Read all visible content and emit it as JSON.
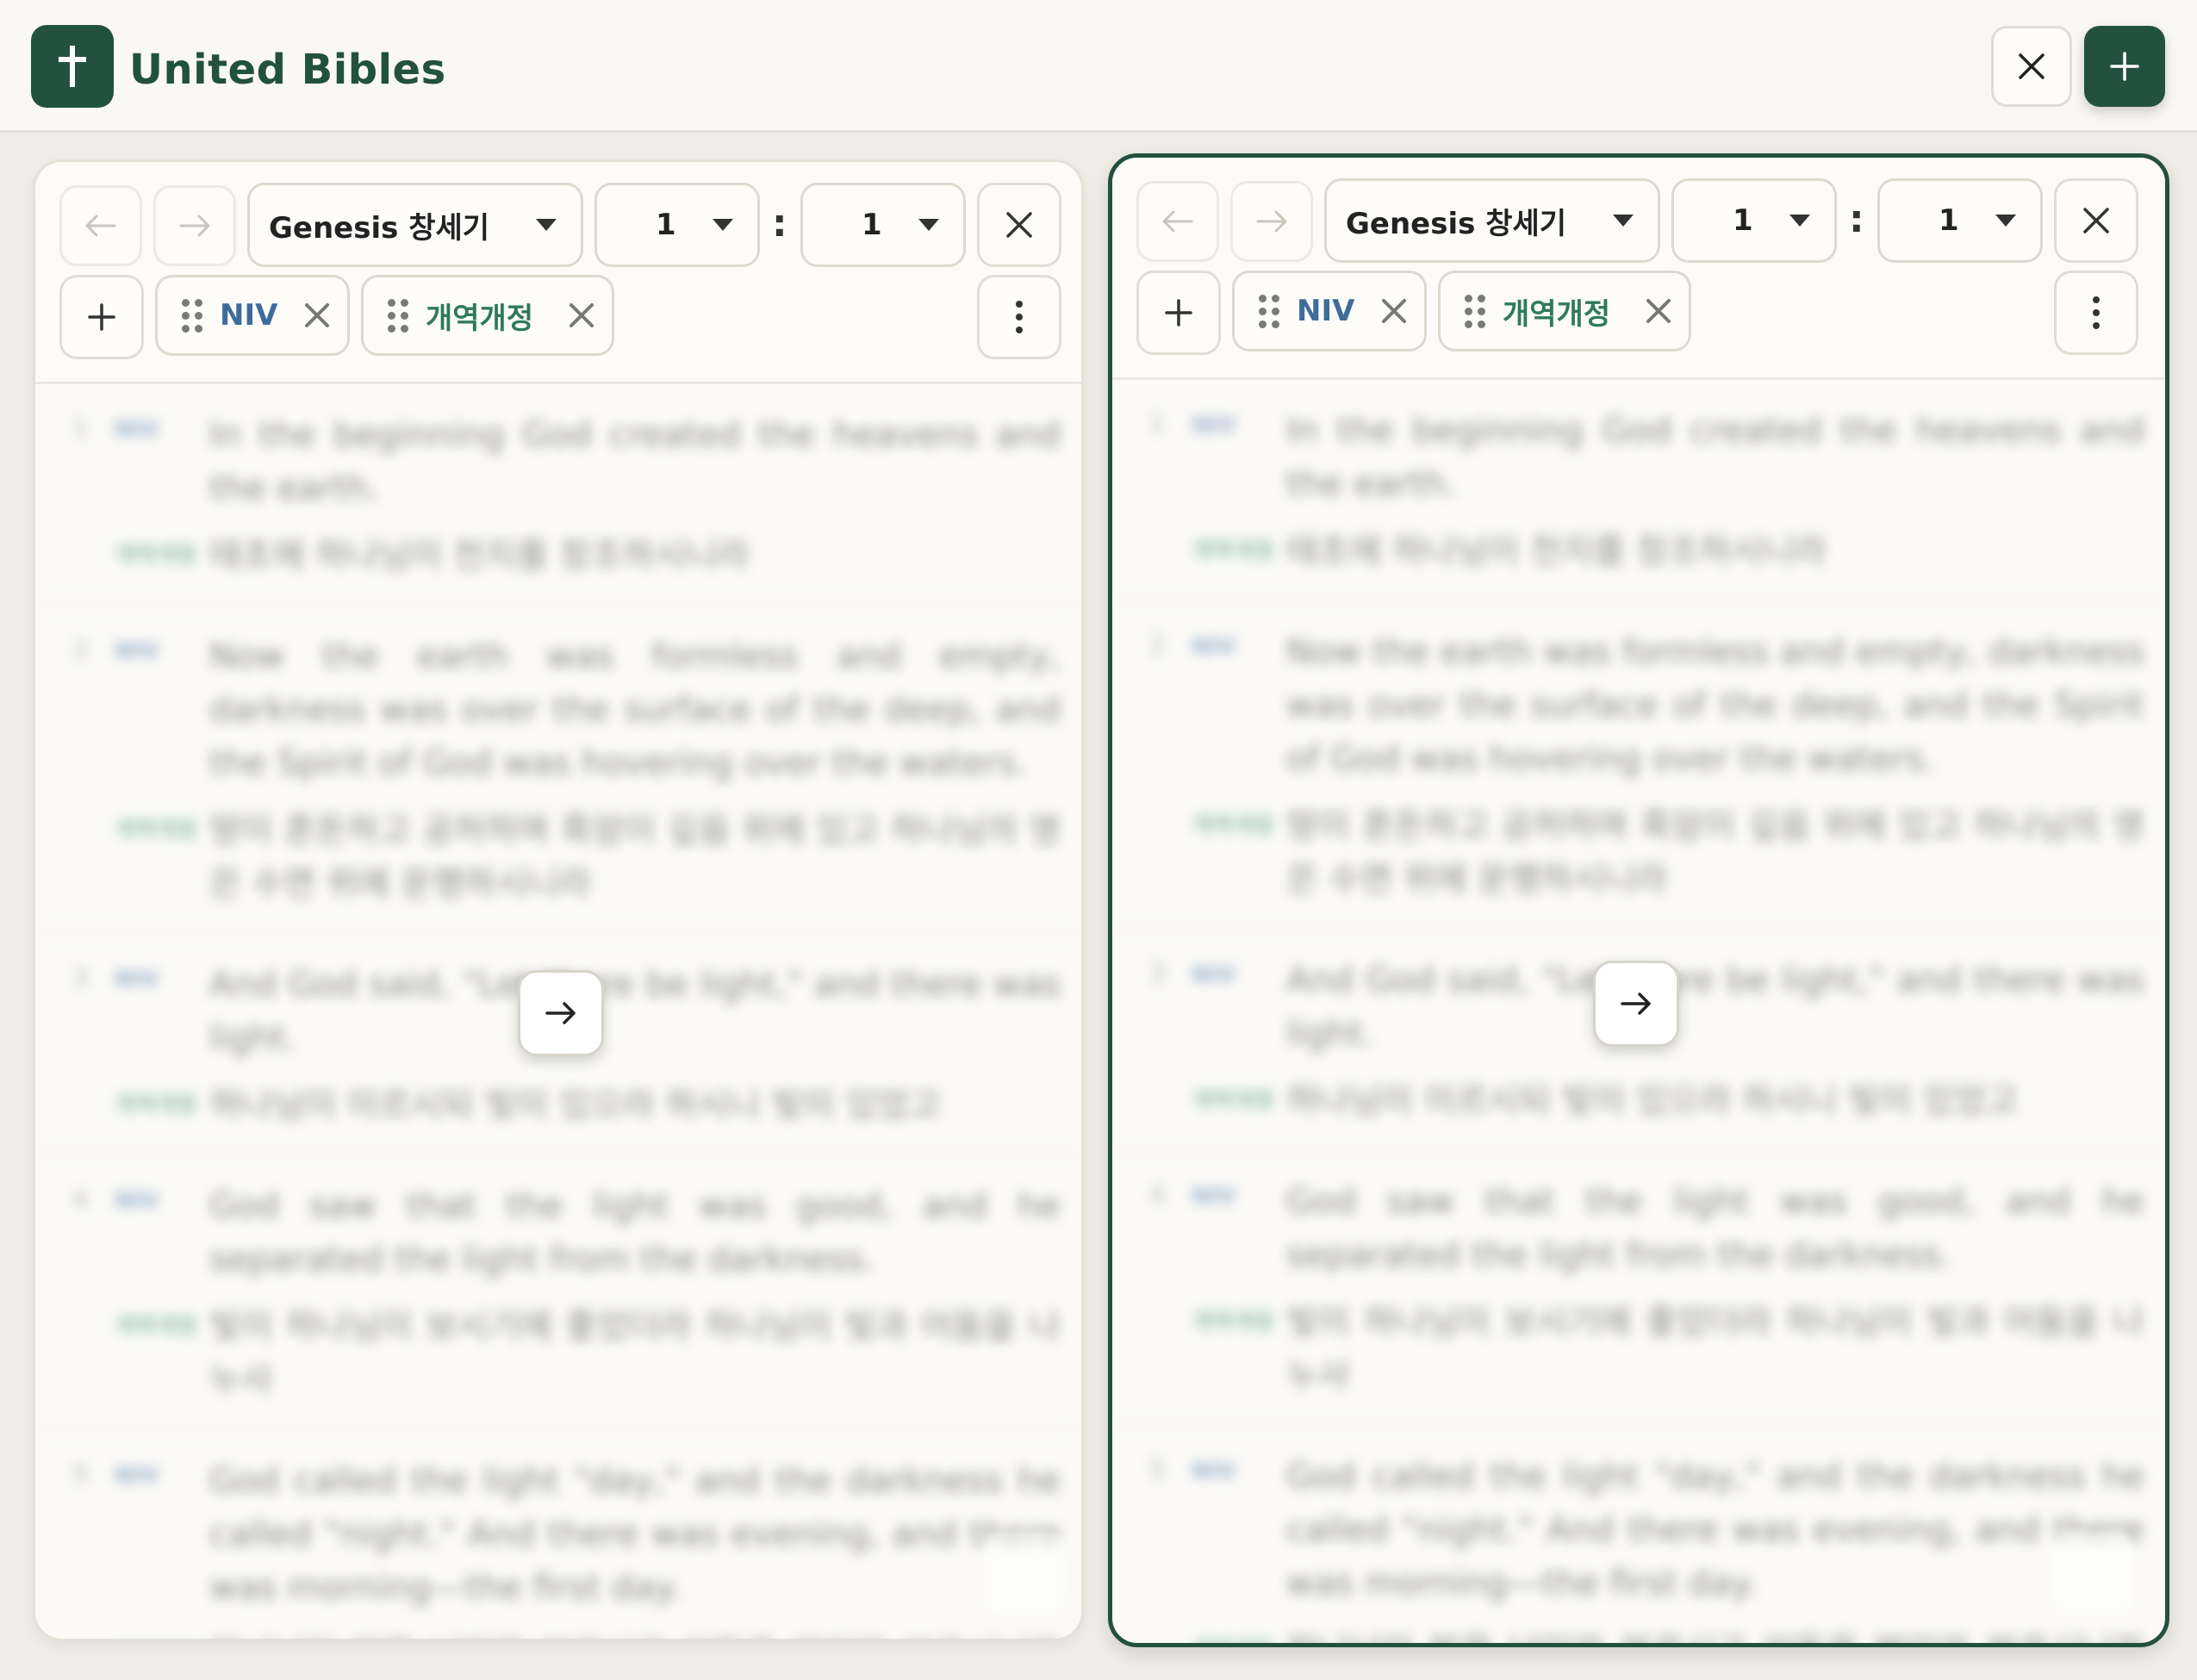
{
  "app": {
    "title": "United Bibles",
    "accent": "#23513f"
  },
  "header": {
    "close_icon": "close-icon",
    "add_icon": "plus-icon"
  },
  "panels": [
    {
      "book": "Genesis 창세기",
      "chapter": "1",
      "verse": "1",
      "translations": [
        {
          "label": "NIV",
          "color": "#4a76a8"
        },
        {
          "label": "개역개정",
          "color": "#2f7a5b"
        }
      ],
      "verses": [
        {
          "num": "1",
          "niv": "In the beginning God created the heavens and the earth.",
          "kr": "태초에 하나님이 천지를 창조하시니라"
        },
        {
          "num": "2",
          "niv": "Now the earth was formless and empty, darkness was over the surface of the deep, and the Spirit of God was hovering over the waters.",
          "kr": "땅이 혼돈하고 공허하며 흑암이 깊음 위에 있고 하나님의 영은 수면 위에 운행하시니라"
        },
        {
          "num": "3",
          "niv": "And God said, \"Let there be light,\" and there was light.",
          "kr": "하나님이 이르시되 빛이 있으라 하시니 빛이 있었고"
        },
        {
          "num": "4",
          "niv": "God saw that the light was good, and he separated the light from the darkness.",
          "kr": "빛이 하나님이 보시기에 좋았더라 하나님이 빛과 어둠을 나누사"
        },
        {
          "num": "5",
          "niv": "God called the light \"day,\" and the darkness he called \"night.\" And there was evening, and there was morning—the first day.",
          "kr": "하나님이 빛을 낮이라 부르시고 어둠을 밤이라 부르시니라 저녁이 되고 아침이 되니 이는 첫째 날이니라"
        }
      ]
    },
    {
      "book": "Genesis 창세기",
      "chapter": "1",
      "verse": "1",
      "translations": [
        {
          "label": "NIV",
          "color": "#4a76a8"
        },
        {
          "label": "개역개정",
          "color": "#2f7a5b"
        }
      ],
      "verses": [
        {
          "num": "1",
          "niv": "In the beginning God created the heavens and the earth.",
          "kr": "태초에 하나님이 천지를 창조하시니라"
        },
        {
          "num": "2",
          "niv": "Now the earth was formless and empty, darkness was over the surface of the deep, and the Spirit of God was hovering over the waters.",
          "kr": "땅이 혼돈하고 공허하며 흑암이 깊음 위에 있고 하나님의 영은 수면 위에 운행하시니라"
        },
        {
          "num": "3",
          "niv": "And God said, \"Let there be light,\" and there was light.",
          "kr": "하나님이 이르시되 빛이 있으라 하시니 빛이 있었고"
        },
        {
          "num": "4",
          "niv": "God saw that the light was good, and he separated the light from the darkness.",
          "kr": "빛이 하나님이 보시기에 좋았더라 하나님이 빛과 어둠을 나누사"
        },
        {
          "num": "5",
          "niv": "God called the light \"day,\" and the darkness he called \"night.\" And there was evening, and there was morning—the first day.",
          "kr": "하나님이 빛을 낮이라 부르시고 어둠을 밤이라 부르시니라 저녁이 되고 아침이 되니 이는 첫째 날이니라"
        }
      ]
    }
  ]
}
